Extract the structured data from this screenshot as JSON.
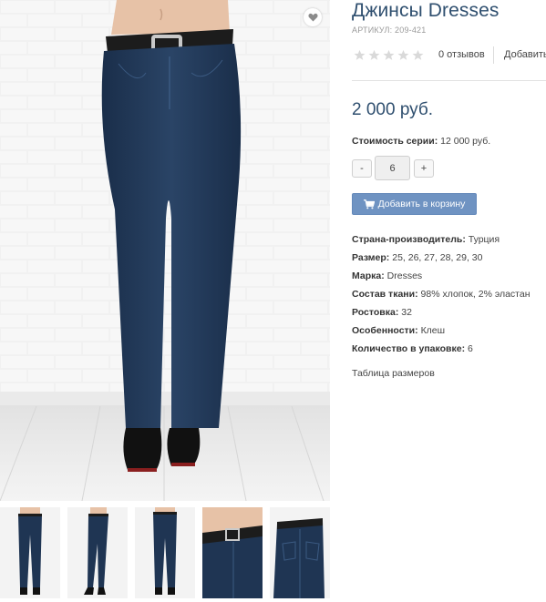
{
  "product": {
    "title": "Джинсы Dresses",
    "article": "АРТИКУЛ: 209-421",
    "reviews": "0 отзывов",
    "add_review": "Добавить",
    "price": "2 000 руб.",
    "series_label": "Стоимость серии:",
    "series_value": "12 000 руб.",
    "quantity": "6",
    "minus_label": "-",
    "plus_label": "+",
    "cart_button": "Добавить в корзину",
    "size_table": "Таблица размеров",
    "rating": 0,
    "rating_max": 5
  },
  "specs": [
    {
      "label": "Страна-производитель:",
      "value": "Турция"
    },
    {
      "label": "Размер:",
      "value": "25, 26, 27, 28, 29, 30"
    },
    {
      "label": "Марка:",
      "value": "Dresses"
    },
    {
      "label": "Состав ткани:",
      "value": "98% хлопок, 2% эластан"
    },
    {
      "label": "Ростовка:",
      "value": "32"
    },
    {
      "label": "Особенности:",
      "value": "Клеш"
    },
    {
      "label": "Количество в упаковке:",
      "value": "6"
    }
  ],
  "icons": {
    "favorite": "heart-icon",
    "star": "star-icon",
    "cart": "cart-icon"
  },
  "colors": {
    "title": "#2f4f6f",
    "button": "#6f93c2",
    "denim": "#1f3553",
    "star_empty": "#d9d9d9"
  },
  "thumbnails": [
    "front-full",
    "side-full",
    "back-full",
    "waist-closeup",
    "back-closeup"
  ]
}
